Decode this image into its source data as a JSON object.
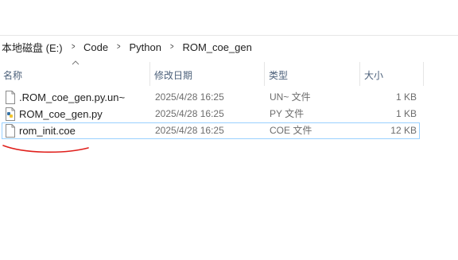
{
  "breadcrumb": [
    "本地磁盘 (E:)",
    "Code",
    "Python",
    "ROM_coe_gen"
  ],
  "columns": {
    "name": "名称",
    "date": "修改日期",
    "type": "类型",
    "size": "大小"
  },
  "files": [
    {
      "name": ".ROM_coe_gen.py.un~",
      "date": "2025/4/28 16:25",
      "type": "UN~ 文件",
      "size": "1 KB",
      "icon": "file-icon"
    },
    {
      "name": "ROM_coe_gen.py",
      "date": "2025/4/28 16:25",
      "type": "PY 文件",
      "size": "1 KB",
      "icon": "python-file-icon"
    },
    {
      "name": "rom_init.coe",
      "date": "2025/4/28 16:25",
      "type": "COE 文件",
      "size": "12 KB",
      "icon": "file-icon"
    }
  ],
  "colors": {
    "selection_border": "#99d1ff",
    "annotation_stroke": "#e0201c",
    "header_text": "#4c607a"
  }
}
